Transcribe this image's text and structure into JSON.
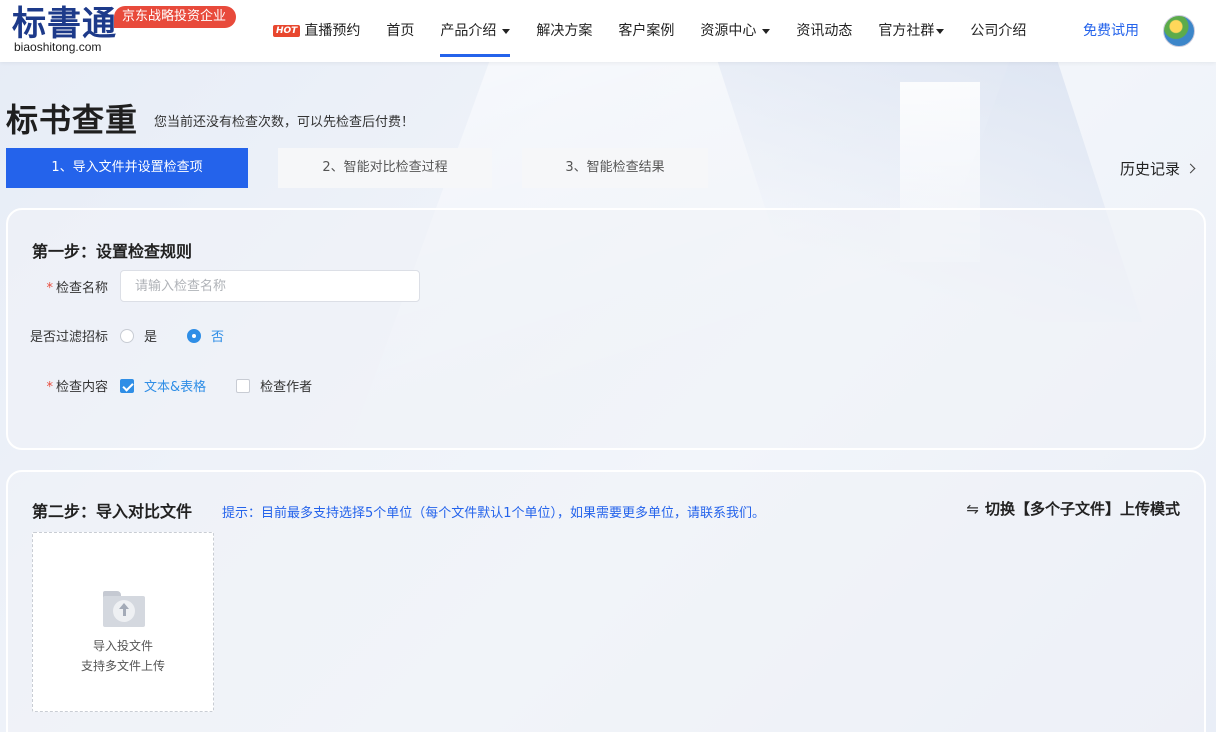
{
  "header": {
    "logo_text": "标書通",
    "logo_sub": "biaoshitong.com",
    "logo_badge": "京东战略投资企业",
    "nav": [
      {
        "label": "直播预约",
        "hot": "HOT"
      },
      {
        "label": "首页"
      },
      {
        "label": "产品介绍",
        "dropdown": true,
        "active": true
      },
      {
        "label": "解决方案"
      },
      {
        "label": "客户案例"
      },
      {
        "label": "资源中心",
        "dropdown": true
      },
      {
        "label": "资讯动态"
      },
      {
        "label": "官方社群",
        "dropdown": true
      },
      {
        "label": "公司介绍"
      }
    ],
    "free_trial": "免费试用"
  },
  "page": {
    "title": "标书查重",
    "tip": "您当前还没有检查次数，可以先检查后付费！",
    "steps": [
      "1、导入文件并设置检查项",
      "2、智能对比检查过程",
      "3、智能检查结果"
    ],
    "history": "历史记录"
  },
  "step1": {
    "title": "第一步：设置检查规则",
    "name_label": "检查名称",
    "name_placeholder": "请输入检查名称",
    "name_value": "",
    "filter_label": "是否过滤招标",
    "filter_yes": "是",
    "filter_no": "否",
    "filter_selected": "否",
    "content_label": "检查内容",
    "content_opt1": "文本&表格",
    "content_opt2": "检查作者",
    "content_checked": [
      "文本&表格"
    ]
  },
  "step2": {
    "title": "第二步：导入对比文件",
    "tip": "提示：目前最多支持选择5个单位（每个文件默认1个单位），如果需要更多单位，请联系我们。",
    "switch_mode": "切换【多个子文件】上传模式",
    "switch_icon": "⇋",
    "upload_line1": "导入投文件",
    "upload_line2": "支持多文件上传"
  },
  "colors": {
    "primary": "#2463eb",
    "accent_blue": "#2f8ee6",
    "badge_red": "#e84a3b",
    "logo_navy": "#1d3a8a"
  }
}
